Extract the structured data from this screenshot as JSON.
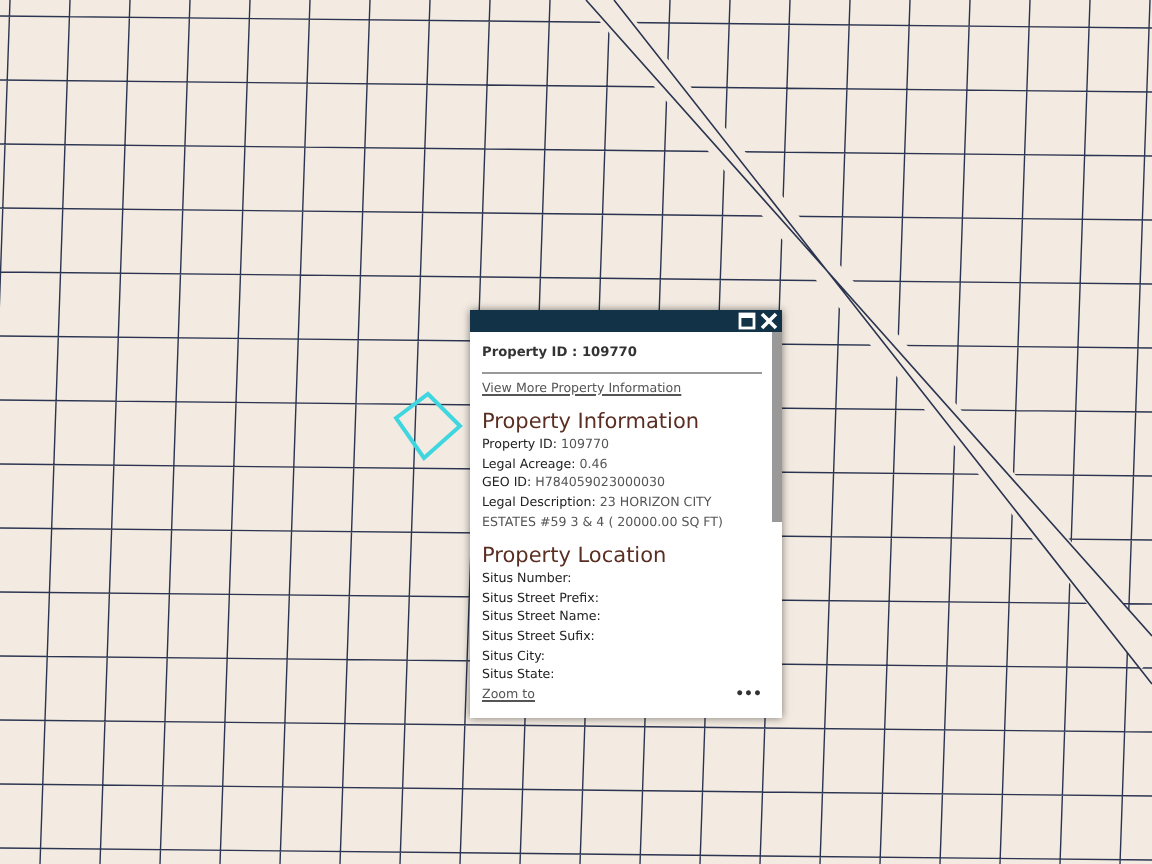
{
  "popup": {
    "title": "Property ID : 109770",
    "link": "View More Property Information",
    "sections": [
      {
        "heading": "Property Information",
        "fields": [
          {
            "label": "Property ID:",
            "value": "109770"
          },
          {
            "label": "Legal Acreage:",
            "value": "0.46"
          },
          {
            "label": "GEO ID:",
            "value": "H784059023000030"
          },
          {
            "label": "Legal Description:",
            "value": "23 HORIZON CITY ESTATES #59 3 & 4 ( 20000.00 SQ FT)"
          }
        ]
      },
      {
        "heading": "Property Location",
        "fields": [
          {
            "label": "Situs Number:"
          },
          {
            "label": "Situs Street Prefix:"
          },
          {
            "label": "Situs Street Name:"
          },
          {
            "label": "Situs Street Sufix:"
          },
          {
            "label": "Situs City:"
          },
          {
            "label": "Situs State:"
          }
        ]
      }
    ],
    "zoom_link": "Zoom to",
    "more": "•••"
  }
}
